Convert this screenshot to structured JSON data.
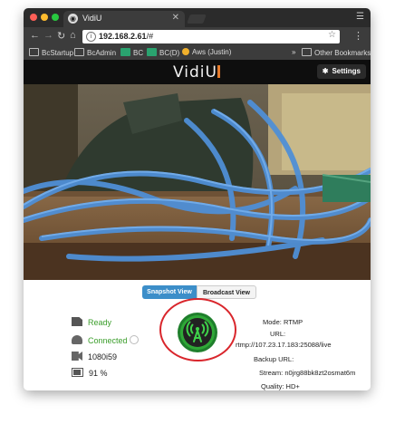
{
  "browser": {
    "tab_title": "VidiU",
    "url_host": "192.168.2.61",
    "url_path": "/#",
    "bookmarks": [
      "BcStartup",
      "BcAdmin",
      "BC",
      "BC(D)",
      "Aws (Justin)"
    ],
    "other_bookmarks": "Other Bookmarks",
    "bookmark_sep": "»"
  },
  "app": {
    "brand": "VidiU",
    "settings_label": "Settings"
  },
  "view_toggle": {
    "snapshot": "Snapshot View",
    "broadcast": "Broadcast View"
  },
  "status": {
    "state": "Ready",
    "connection": "Connected",
    "resolution": "1080i59",
    "battery": "91 %",
    "battery_level": 0.91
  },
  "broadcast_info": {
    "mode_label": "Mode:",
    "mode_value": "RTMP",
    "url_label": "URL:",
    "url_value": "rtmp://107.23.17.183:25088/live",
    "backup_label": "Backup URL:",
    "stream_label": "Stream:",
    "stream_value": "n0jrg88bk8zt2osmat6m",
    "quality_label": "Quality:",
    "quality_value": "HD+"
  },
  "colors": {
    "accent_blue": "#3c8ec9",
    "ready_green": "#3a9d2a",
    "broadcast_green": "#2fa837",
    "highlight_red": "#d9262c"
  }
}
